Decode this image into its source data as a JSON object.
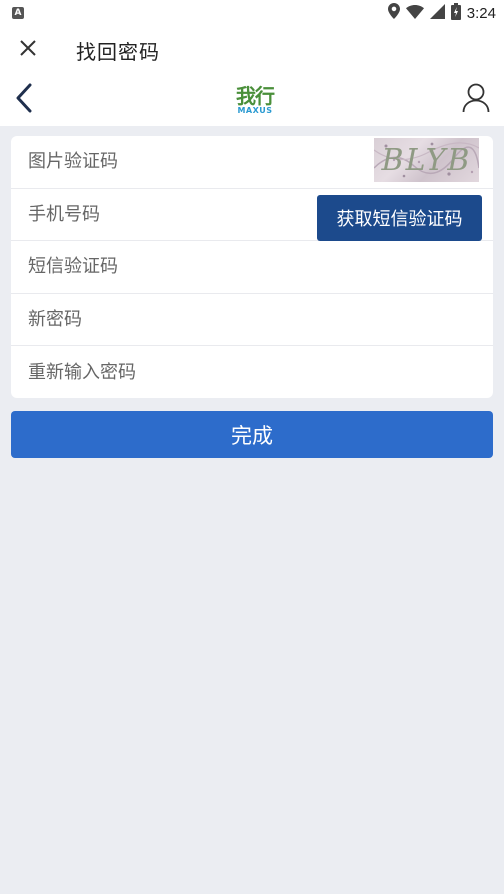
{
  "status_bar": {
    "time": "3:24",
    "notification_icon_letter": "A",
    "icons": [
      "location-icon",
      "wifi-icon",
      "signal-icon",
      "battery-charging-icon"
    ]
  },
  "title_bar": {
    "title": "找回密码",
    "close_icon": "close-icon"
  },
  "nav_bar": {
    "back_icon": "chevron-left-icon",
    "logo_cn": "我行",
    "logo_en": "MAXUS",
    "user_icon": "user-icon"
  },
  "form": {
    "image_code": {
      "placeholder": "图片验证码",
      "value": "",
      "captcha_text": "BLYB"
    },
    "phone": {
      "placeholder": "手机号码",
      "value": ""
    },
    "sms_button_label": "获取短信验证码",
    "sms_code": {
      "placeholder": "短信验证码",
      "value": ""
    },
    "new_password": {
      "placeholder": "新密码",
      "value": ""
    },
    "confirm_password": {
      "placeholder": "重新输入密码",
      "value": ""
    }
  },
  "done_button_label": "完成",
  "colors": {
    "page_background": "#ebedf2",
    "sms_button": "#1c4a8c",
    "done_button": "#2d6ccb",
    "logo_green": "#4a8f3a",
    "logo_blue": "#2a9ad1"
  }
}
